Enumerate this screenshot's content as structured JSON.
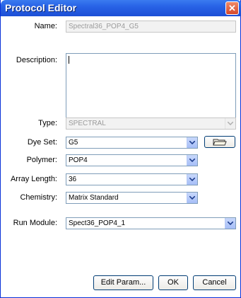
{
  "window": {
    "title": "Protocol Editor",
    "close_symbol": "✕"
  },
  "form": {
    "name": {
      "label": "Name:",
      "value": "Spectral36_POP4_G5"
    },
    "description": {
      "label": "Description:",
      "value": ""
    },
    "type": {
      "label": "Type:",
      "value": "SPECTRAL"
    },
    "dye_set": {
      "label": "Dye Set:",
      "value": "G5"
    },
    "polymer": {
      "label": "Polymer:",
      "value": "POP4"
    },
    "array_length": {
      "label": "Array Length:",
      "value": "36"
    },
    "chemistry": {
      "label": "Chemistry:",
      "value": "Matrix Standard"
    },
    "run_module": {
      "label": "Run Module:",
      "value": "Spect36_POP4_1"
    }
  },
  "buttons": {
    "edit_param": "Edit Param...",
    "ok": "OK",
    "cancel": "Cancel"
  },
  "icons": {
    "close": "close-icon",
    "folder": "folder-open-icon",
    "dropdown": "chevron-down-icon"
  }
}
